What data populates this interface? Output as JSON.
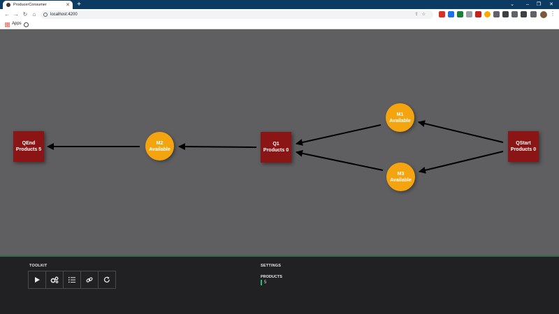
{
  "browser": {
    "tab_title": "ProducerConsumer",
    "url": "localhost:4200",
    "bookmark_apps": "Apps"
  },
  "graph": {
    "queues": [
      {
        "id": "qend",
        "name": "QEnd",
        "products": "Products 5"
      },
      {
        "id": "q1",
        "name": "Q1",
        "products": "Products 0"
      },
      {
        "id": "qstart",
        "name": "QStart",
        "products": "Products 0"
      }
    ],
    "machines": [
      {
        "id": "m1",
        "name": "M1",
        "status": "Available"
      },
      {
        "id": "m2",
        "name": "M2",
        "status": "Available"
      },
      {
        "id": "m3",
        "name": "M3",
        "status": "Available"
      }
    ],
    "colors": {
      "queue": "#8b1414",
      "machine": "#f4a40e",
      "arrow": "#000000"
    }
  },
  "toolkit": {
    "heading": "TOOLKIT",
    "tools": [
      "play-icon",
      "gears-icon",
      "list-icon",
      "link-icon",
      "refresh-icon"
    ]
  },
  "settings": {
    "heading": "SETTINGS",
    "products_label": "PRODUCTS",
    "products_value": "5"
  }
}
